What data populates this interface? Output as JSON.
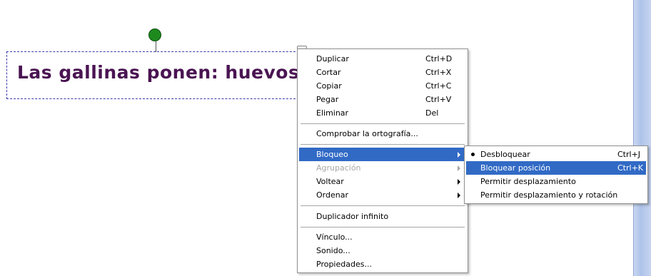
{
  "text_object": {
    "content": "Las gallinas ponen: huevos"
  },
  "context_menu": {
    "items": [
      {
        "label": "Duplicar",
        "shortcut": "Ctrl+D"
      },
      {
        "label": "Cortar",
        "shortcut": "Ctrl+X"
      },
      {
        "label": "Copiar",
        "shortcut": "Ctrl+C"
      },
      {
        "label": "Pegar",
        "shortcut": "Ctrl+V"
      },
      {
        "label": "Eliminar",
        "shortcut": "Del"
      },
      {
        "label": "Comprobar la ortografía..."
      },
      {
        "label": "Bloqueo",
        "state": "highlighted",
        "submenu": true
      },
      {
        "label": "Agrupación",
        "state": "disabled",
        "submenu": true
      },
      {
        "label": "Voltear",
        "submenu": true
      },
      {
        "label": "Ordenar",
        "submenu": true
      },
      {
        "label": "Duplicador infinito"
      },
      {
        "label": "Vínculo..."
      },
      {
        "label": "Sonido..."
      },
      {
        "label": "Propiedades..."
      }
    ]
  },
  "lock_submenu": {
    "items": [
      {
        "label": "Desbloquear",
        "shortcut": "Ctrl+J",
        "checked": true
      },
      {
        "label": "Bloquear posición",
        "shortcut": "Ctrl+K",
        "state": "highlighted"
      },
      {
        "label": "Permitir desplazamiento"
      },
      {
        "label": "Permitir desplazamiento y rotación"
      }
    ]
  },
  "colors": {
    "text_color": "#4a1452",
    "highlight": "#316ac5",
    "rotate_handle": "#1e8a1e",
    "selection_border": "#3a3aa8"
  }
}
